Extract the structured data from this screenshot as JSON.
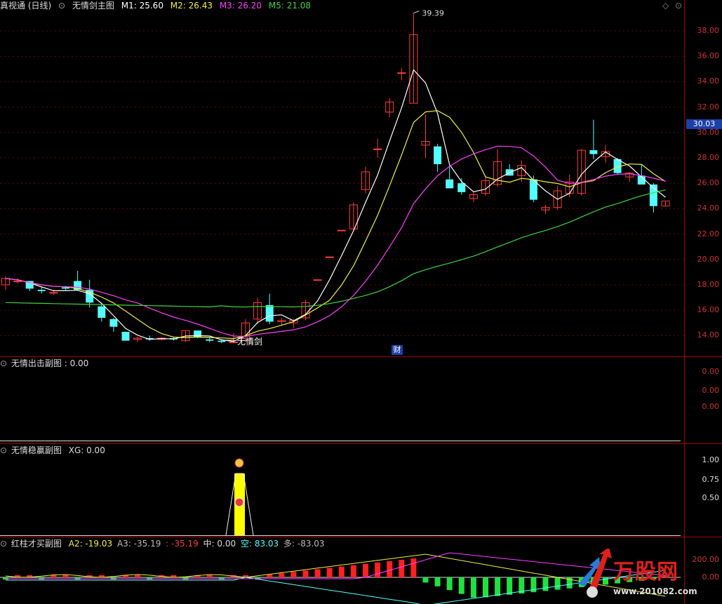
{
  "main": {
    "app": "真视通 (日线)",
    "indicator": "无情剑主图",
    "m1": "M1: 25.60",
    "m2": "M2: 26.43",
    "m3": "M3: 26.20",
    "m5": "M5: 21.08",
    "high_label": "39.39",
    "signal_label": "无情剑",
    "cai_label": "财",
    "current_price": "30.03",
    "ticks": [
      "38.00",
      "36.00",
      "34.00",
      "32.00",
      "30.00",
      "28.00",
      "26.00",
      "24.00",
      "22.00",
      "20.00",
      "18.00",
      "16.00",
      "14.00"
    ]
  },
  "sub1": {
    "title": "无情出击副图 : 0.00",
    "ticks": [
      "0.00",
      "0.00",
      "0.00"
    ]
  },
  "sub2": {
    "title": "无情稳赢副图",
    "xg": "XG: 0.00",
    "ticks": [
      "1.00",
      "0.75",
      "0.50"
    ]
  },
  "sub3": {
    "title": "红柱才买副图",
    "a2": "A2: -19.03",
    "a3": "A3: -35.19",
    "colon": ": -35.19",
    "zhong": "中: 0.00",
    "kong_label": "空",
    "kong_val": ": 83.03",
    "duo": "多: -83.03",
    "ticks": [
      "200.00",
      "0.00"
    ]
  },
  "watermark": {
    "brand": "万股网",
    "url": "www.201082.com"
  },
  "colors": {
    "up": "#ff3d3d",
    "down": "#54ffff",
    "m1": "#ffffff",
    "m2": "#f0f040",
    "m3": "#ff40ff",
    "m5": "#3fd43f"
  },
  "chart_data": {
    "type": "candlestick",
    "price_range": [
      13,
      39.5
    ],
    "candles": [
      {
        "o": 18.0,
        "h": 18.7,
        "l": 17.6,
        "c": 18.5
      },
      {
        "o": 18.3,
        "h": 18.5,
        "l": 18.1,
        "c": 18.3
      },
      {
        "o": 18.3,
        "h": 18.3,
        "l": 17.5,
        "c": 17.7
      },
      {
        "o": 17.6,
        "h": 17.8,
        "l": 17.3,
        "c": 17.5
      },
      {
        "o": 17.4,
        "h": 17.6,
        "l": 17.2,
        "c": 17.4
      },
      {
        "o": 17.8,
        "h": 17.9,
        "l": 17.6,
        "c": 17.7
      },
      {
        "o": 18.3,
        "h": 19.1,
        "l": 17.8,
        "c": 17.6
      },
      {
        "o": 17.6,
        "h": 18.4,
        "l": 16.2,
        "c": 16.6
      },
      {
        "o": 16.3,
        "h": 16.5,
        "l": 15.1,
        "c": 15.4
      },
      {
        "o": 15.3,
        "h": 15.4,
        "l": 14.3,
        "c": 14.7
      },
      {
        "o": 14.3,
        "h": 14.3,
        "l": 13.6,
        "c": 13.6
      },
      {
        "o": 13.7,
        "h": 13.9,
        "l": 13.5,
        "c": 13.8
      },
      {
        "o": 13.8,
        "h": 14.0,
        "l": 13.6,
        "c": 13.7
      },
      {
        "o": 13.7,
        "h": 13.9,
        "l": 13.6,
        "c": 13.8
      },
      {
        "o": 13.8,
        "h": 13.9,
        "l": 13.6,
        "c": 13.7
      },
      {
        "o": 13.6,
        "h": 14.4,
        "l": 13.5,
        "c": 14.4
      },
      {
        "o": 14.4,
        "h": 14.4,
        "l": 13.8,
        "c": 13.9
      },
      {
        "o": 13.7,
        "h": 13.9,
        "l": 13.5,
        "c": 13.6
      },
      {
        "o": 13.6,
        "h": 13.7,
        "l": 13.4,
        "c": 13.5
      },
      {
        "o": 13.5,
        "h": 14.2,
        "l": 13.4,
        "c": 13.5
      },
      {
        "o": 13.6,
        "h": 15.3,
        "l": 13.5,
        "c": 15.0
      },
      {
        "o": 15.3,
        "h": 17.0,
        "l": 14.9,
        "c": 16.6
      },
      {
        "o": 16.4,
        "h": 17.3,
        "l": 14.9,
        "c": 15.1
      },
      {
        "o": 15.1,
        "h": 15.4,
        "l": 14.8,
        "c": 15.2
      },
      {
        "o": 15.0,
        "h": 15.3,
        "l": 14.6,
        "c": 15.2
      },
      {
        "o": 15.4,
        "h": 16.8,
        "l": 15.2,
        "c": 16.6
      },
      {
        "o": 18.4,
        "h": 18.4,
        "l": 18.4,
        "c": 18.4
      },
      {
        "o": 20.2,
        "h": 20.2,
        "l": 20.2,
        "c": 20.2
      },
      {
        "o": 22.3,
        "h": 22.3,
        "l": 22.3,
        "c": 22.3
      },
      {
        "o": 22.4,
        "h": 24.5,
        "l": 22.3,
        "c": 24.3
      },
      {
        "o": 25.5,
        "h": 27.3,
        "l": 25.2,
        "c": 26.9
      },
      {
        "o": 28.7,
        "h": 29.5,
        "l": 28.0,
        "c": 28.7
      },
      {
        "o": 31.6,
        "h": 32.7,
        "l": 31.2,
        "c": 32.4
      },
      {
        "o": 34.7,
        "h": 35.1,
        "l": 34.1,
        "c": 34.7
      },
      {
        "o": 32.3,
        "h": 39.4,
        "l": 32.3,
        "c": 37.7
      },
      {
        "o": 29.0,
        "h": 31.4,
        "l": 28.0,
        "c": 29.3
      },
      {
        "o": 28.9,
        "h": 29.1,
        "l": 26.9,
        "c": 27.5
      },
      {
        "o": 26.3,
        "h": 27.4,
        "l": 25.6,
        "c": 25.6
      },
      {
        "o": 26.0,
        "h": 26.4,
        "l": 25.1,
        "c": 25.3
      },
      {
        "o": 24.8,
        "h": 25.3,
        "l": 24.5,
        "c": 25.1
      },
      {
        "o": 25.2,
        "h": 26.6,
        "l": 25.0,
        "c": 26.2
      },
      {
        "o": 25.9,
        "h": 28.7,
        "l": 25.7,
        "c": 27.7
      },
      {
        "o": 27.1,
        "h": 27.5,
        "l": 26.6,
        "c": 26.6
      },
      {
        "o": 26.6,
        "h": 27.8,
        "l": 26.1,
        "c": 27.4
      },
      {
        "o": 26.3,
        "h": 26.6,
        "l": 24.5,
        "c": 24.7
      },
      {
        "o": 23.9,
        "h": 24.3,
        "l": 23.6,
        "c": 24.1
      },
      {
        "o": 24.1,
        "h": 25.8,
        "l": 23.9,
        "c": 25.4
      },
      {
        "o": 25.2,
        "h": 26.7,
        "l": 24.9,
        "c": 26.1
      },
      {
        "o": 25.2,
        "h": 28.7,
        "l": 25.0,
        "c": 28.6
      },
      {
        "o": 28.6,
        "h": 31.0,
        "l": 27.9,
        "c": 28.3
      },
      {
        "o": 28.1,
        "h": 29.0,
        "l": 27.6,
        "c": 28.5
      },
      {
        "o": 27.9,
        "h": 28.0,
        "l": 26.7,
        "c": 26.8
      },
      {
        "o": 26.5,
        "h": 26.9,
        "l": 26.1,
        "c": 26.8
      },
      {
        "o": 26.6,
        "h": 27.5,
        "l": 25.9,
        "c": 25.9
      },
      {
        "o": 25.9,
        "h": 26.0,
        "l": 23.7,
        "c": 24.2
      },
      {
        "o": 24.2,
        "h": 24.6,
        "l": 24.2,
        "c": 24.6
      }
    ]
  }
}
